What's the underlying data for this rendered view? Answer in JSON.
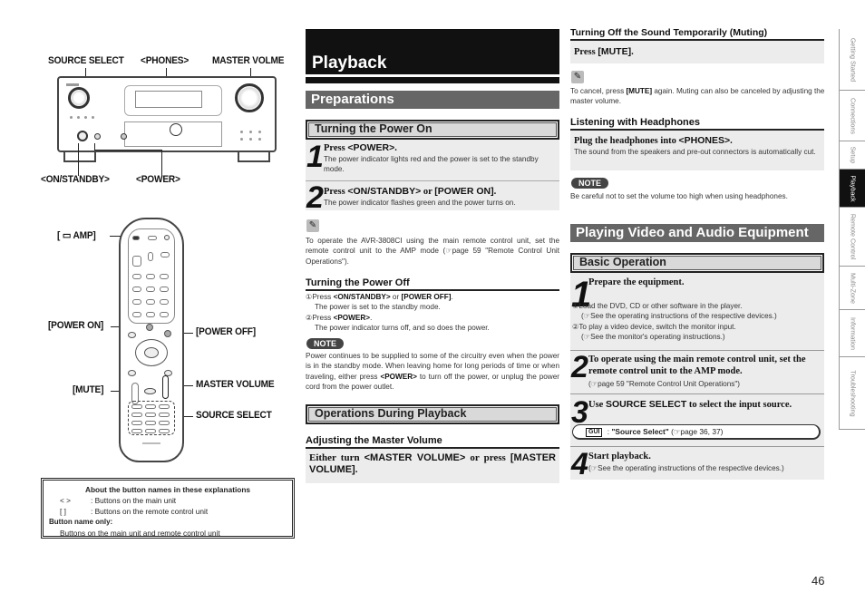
{
  "illustrations": {
    "receiver_callouts": {
      "source_select": "SOURCE SELECT",
      "phones": "<PHONES>",
      "master_volume": "MASTER VOLME",
      "on_standby": "<ON/STANDBY>",
      "power": "<POWER>"
    },
    "remote_callouts": {
      "amp": "[ ▭ AMP]",
      "power_on": "[POWER ON]",
      "power_off": "[POWER OFF]",
      "mute": "[MUTE]",
      "master_volume": "MASTER VOLUME",
      "source_select": "SOURCE SELECT"
    }
  },
  "legend": {
    "title": "About the button names in these explanations",
    "rows": [
      {
        "symbol": "<   >",
        "text": ": Buttons on the main unit"
      },
      {
        "symbol": "[   ]",
        "text": ": Buttons on the remote control unit"
      }
    ],
    "button_name_only_label": "Button name only:",
    "button_name_only_text": "Buttons on the main unit and remote control unit"
  },
  "chapter": {
    "title": "Playback"
  },
  "preparations": {
    "title": "Preparations",
    "power_on": {
      "title": "Turning the Power On",
      "steps": [
        {
          "num": "1",
          "prefix": "Press ",
          "key": "<POWER>",
          "suffix": ".",
          "desc": "The power indicator lights red and the power is set to the standby mode."
        },
        {
          "num": "2",
          "prefix": "Press ",
          "key": "<ON/STANDBY>",
          "mid": " or ",
          "key2": "[POWER ON]",
          "suffix": ".",
          "desc": "The power indicator flashes green and the power turns on."
        }
      ],
      "memo_icon": "pencil-icon",
      "memo": "To operate the AVR-3808CI using the main remote control unit, set the remote control unit to the AMP mode (☞page 59 \"Remote Control Unit Operations\")."
    },
    "power_off": {
      "title": "Turning the Power Off",
      "items": [
        {
          "marker": "①",
          "text": "Press ",
          "key": "<ON/STANDBY>",
          "mid": " or ",
          "key2": "[POWER OFF]",
          "end": ".",
          "sub": "The power is set to the standby mode."
        },
        {
          "marker": "②",
          "text": "Press ",
          "key": "<POWER>",
          "end": ".",
          "sub": "The power indicator turns off, and so does the power."
        }
      ],
      "note_label": "NOTE",
      "note_pre": "Power continues to be supplied to some of the circuitry even when the power is in the standby mode. When leaving home for long periods of time or when traveling, either press ",
      "note_key": "<POWER>",
      "note_post": " to turn off the power, or unplug the power cord from the power outlet."
    }
  },
  "operations": {
    "title": "Operations During Playback",
    "master_volume": {
      "title": "Adjusting the Master Volume",
      "pre": "Either turn ",
      "key": "<MASTER VOLUME>",
      "mid": " or press ",
      "key2": "[MASTER VOLUME]",
      "end": "."
    },
    "muting": {
      "title": "Turning Off the Sound Temporarily (Muting)",
      "pre": "Press ",
      "key": "[MUTE]",
      "end": ".",
      "memo_pre": "To cancel, press ",
      "memo_key": "[MUTE]",
      "memo_post": " again. Muting can also be canceled by adjusting the master volume."
    },
    "headphones": {
      "title": "Listening with Headphones",
      "pre": "Plug the headphones into ",
      "key": "<PHONES>",
      "end": ".",
      "desc": "The sound from the speakers and pre-out connectors is automatically cut.",
      "note_label": "NOTE",
      "note": "Be careful not to set the volume too high when using headphones."
    }
  },
  "playing": {
    "title": "Playing Video and Audio Equipment",
    "basic": {
      "title": "Basic Operation",
      "step1": {
        "num": "1",
        "heading": "Prepare the equipment.",
        "items": [
          {
            "marker": "①",
            "text": "Load the DVD, CD or other software in the player.",
            "ref": "(☞See the operating instructions of the respective devices.)"
          },
          {
            "marker": "②",
            "text": "To play a video device, switch the monitor input.",
            "ref": "(☞See the monitor's operating instructions.)"
          }
        ]
      },
      "step2": {
        "num": "2",
        "heading": "To operate using the main remote control unit, set the remote control unit to the AMP mode.",
        "ref": "(☞page 59 \"Remote Control Unit Operations\")"
      },
      "step3": {
        "num": "3",
        "pre": "Use ",
        "key": "SOURCE SELECT",
        "post": " to select the input source.",
        "gui_label": "GUI",
        "gui_text": "\"Source Select\"",
        "gui_ref": " (☞page 36, 37)"
      },
      "step4": {
        "num": "4",
        "heading": "Start playback.",
        "ref": "(☞See the operating instructions of the respective devices.)"
      }
    }
  },
  "side_tabs": [
    {
      "label": "Getting Started",
      "active": false
    },
    {
      "label": "Connections",
      "active": false
    },
    {
      "label": "Setup",
      "active": false
    },
    {
      "label": "Playback",
      "active": true
    },
    {
      "label": "Remote Control",
      "active": false
    },
    {
      "label": "Multi-Zone",
      "active": false
    },
    {
      "label": "Information",
      "active": false
    },
    {
      "label": "Troubleshooting",
      "active": false
    }
  ],
  "page_number": "46"
}
